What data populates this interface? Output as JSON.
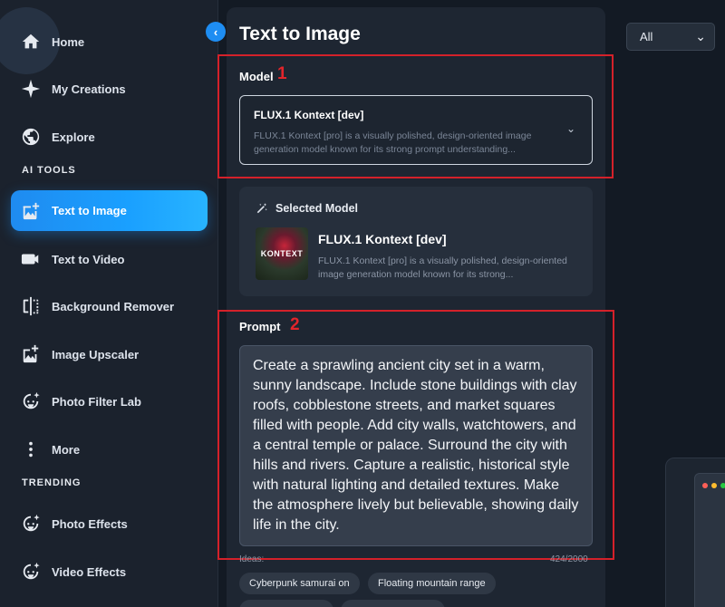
{
  "sidebar": {
    "items": [
      {
        "label": "Home",
        "icon": "home-icon"
      },
      {
        "label": "My Creations",
        "icon": "sparkle-icon"
      },
      {
        "label": "Explore",
        "icon": "globe-icon"
      }
    ],
    "ai_tools_label": "AI TOOLS",
    "ai_tools": [
      {
        "label": "Text to Image",
        "icon": "image-plus-icon",
        "active": true
      },
      {
        "label": "Text to Video",
        "icon": "video-icon"
      },
      {
        "label": "Background Remover",
        "icon": "split-frame-icon"
      },
      {
        "label": "Image Upscaler",
        "icon": "image-upscale-icon"
      },
      {
        "label": "Photo Filter Lab",
        "icon": "face-sparkle-icon"
      },
      {
        "label": "More",
        "icon": "more-vertical-icon"
      }
    ],
    "trending_label": "TRENDING",
    "trending": [
      {
        "label": "Photo Effects",
        "icon": "face-sparkle-icon"
      },
      {
        "label": "Video Effects",
        "icon": "face-sparkle-icon"
      }
    ]
  },
  "main": {
    "title": "Text to Image",
    "model": {
      "label": "Model",
      "selected_name": "FLUX.1 Kontext [dev]",
      "selected_desc": "FLUX.1 Kontext [pro] is a visually polished, design-oriented image generation model known for its strong prompt understanding..."
    },
    "selected_model": {
      "label": "Selected Model",
      "name": "FLUX.1 Kontext [dev]",
      "desc": "FLUX.1 Kontext [pro] is a visually polished, design-oriented image generation model known for its strong...",
      "thumb_text": "KONTEXT"
    },
    "prompt": {
      "label": "Prompt",
      "text": "Create a sprawling ancient city set in a warm, sunny landscape. Include stone buildings with clay roofs, cobblestone streets, and market squares filled with people. Add city walls, watchtowers, and a central temple or palace. Surround the city with hills and rivers. Capture a realistic, historical style with natural lighting and detailed textures. Make the atmosphere lively but believable, showing daily life in the city.",
      "ideas_label": "Ideas:",
      "counter": "424/2000"
    },
    "chips": [
      "Cyberpunk samurai on",
      "Floating mountain range"
    ],
    "annotations": [
      "1",
      "2"
    ]
  },
  "filter": {
    "selected": "All"
  },
  "colors": {
    "accent": "#1e8df2",
    "highlight": "#d4212a"
  }
}
